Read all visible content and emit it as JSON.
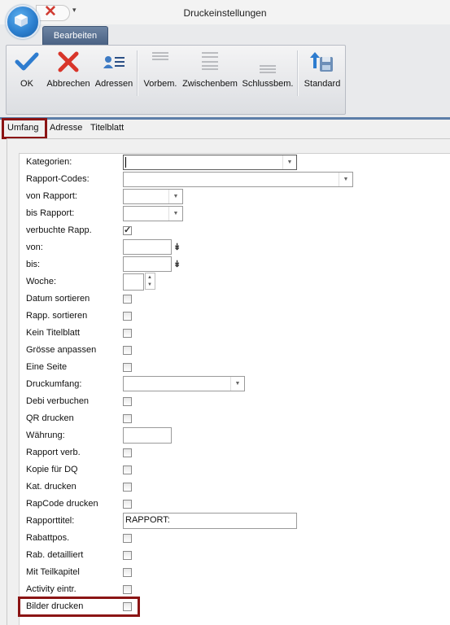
{
  "window": {
    "title": "Druckeinstellungen"
  },
  "ribbon": {
    "tab": "Bearbeiten",
    "buttons": [
      {
        "id": "ok",
        "label": "OK",
        "icon": "checkmark-icon"
      },
      {
        "id": "abbrechen",
        "label": "Abbrechen",
        "icon": "close-icon"
      },
      {
        "id": "adressen",
        "label": "Adressen",
        "icon": "address-book-icon"
      },
      {
        "id": "vorbem",
        "label": "Vorbem.",
        "icon": "text-lines-icon"
      },
      {
        "id": "zwischenbem",
        "label": "Zwischenbem",
        "icon": "text-lines-icon"
      },
      {
        "id": "schlussbem",
        "label": "Schlussbem.",
        "icon": "text-lines-icon"
      },
      {
        "id": "standard",
        "label": "Standard",
        "icon": "save-default-icon"
      }
    ]
  },
  "tabs": [
    "Umfang",
    "Adresse",
    "Titelblatt"
  ],
  "form": {
    "kategorien": {
      "label": "Kategorien:",
      "value": ""
    },
    "rapport_codes": {
      "label": "Rapport-Codes:",
      "value": ""
    },
    "von_rapport": {
      "label": "von Rapport:",
      "value": ""
    },
    "bis_rapport": {
      "label": "bis Rapport:",
      "value": ""
    },
    "verbuchte_rapp": {
      "label": "verbuchte Rapp.",
      "checked": true
    },
    "von": {
      "label": "von:",
      "value": ""
    },
    "bis": {
      "label": "bis:",
      "value": ""
    },
    "woche": {
      "label": "Woche:",
      "value": ""
    },
    "datum_sortieren": {
      "label": "Datum sortieren",
      "checked": false
    },
    "rapp_sortieren": {
      "label": "Rapp. sortieren",
      "checked": false
    },
    "kein_titelblatt": {
      "label": "Kein Titelblatt",
      "checked": false
    },
    "groesse_anpassen": {
      "label": "Grösse anpassen",
      "checked": false
    },
    "eine_seite": {
      "label": "Eine Seite",
      "checked": false
    },
    "druckumfang": {
      "label": "Druckumfang:",
      "value": ""
    },
    "debi_verbuchen": {
      "label": "Debi verbuchen",
      "checked": false
    },
    "qr_drucken": {
      "label": "QR drucken",
      "checked": false
    },
    "waehrung": {
      "label": "Währung:",
      "value": ""
    },
    "rapport_verb": {
      "label": "Rapport verb.",
      "checked": false
    },
    "kopie_dq": {
      "label": "Kopie für DQ",
      "checked": false
    },
    "kat_drucken": {
      "label": "Kat. drucken",
      "checked": false
    },
    "rapcode_drucken": {
      "label": "RapCode drucken",
      "checked": false
    },
    "rapporttitel": {
      "label": "Rapporttitel:",
      "value": "RAPPORT:"
    },
    "rabattpos": {
      "label": "Rabattpos.",
      "checked": false
    },
    "rab_detailliert": {
      "label": "Rab. detailliert",
      "checked": false
    },
    "mit_teilkapitel": {
      "label": "Mit Teilkapitel",
      "checked": false
    },
    "activity_eintr": {
      "label": "Activity eintr.",
      "checked": false
    },
    "bilder_drucken": {
      "label": "Bilder drucken",
      "checked": false
    }
  },
  "colors": {
    "highlight": "#8b1414",
    "ribbon_tab": "#5a7294",
    "accent_line": "#5c7ea8"
  }
}
